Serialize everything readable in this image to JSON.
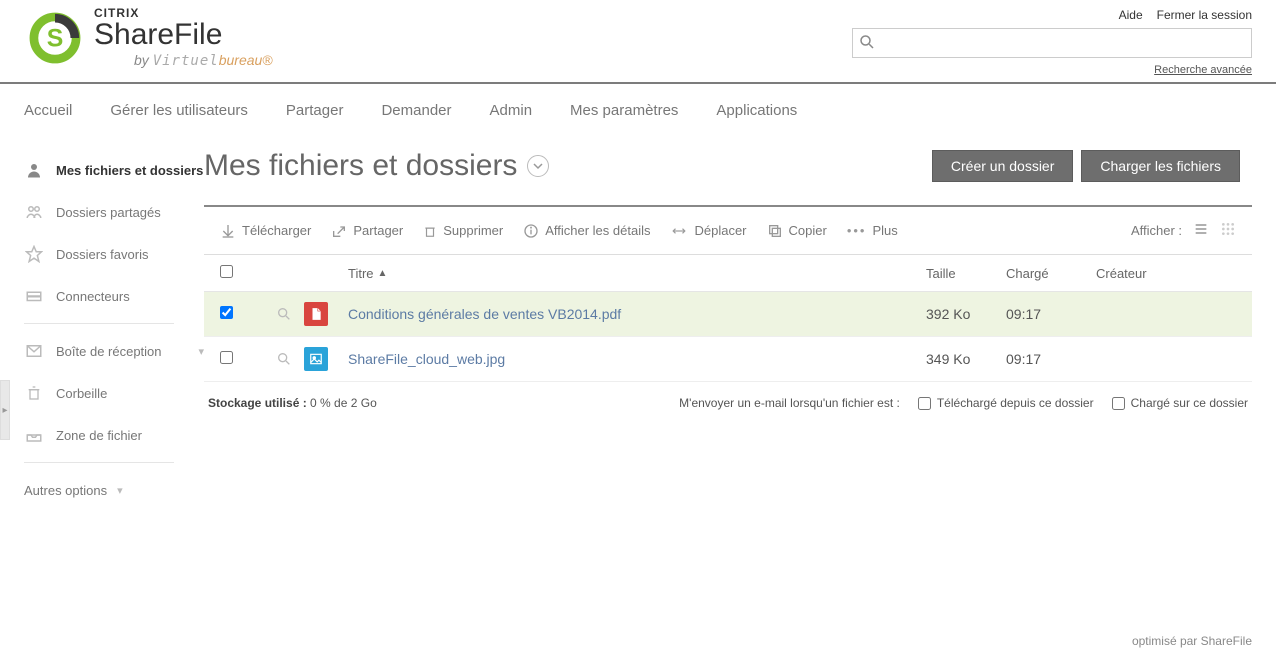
{
  "header": {
    "brand_top": "CITRIX",
    "brand_main": "ShareFile",
    "by": "by ",
    "virtuel": "Virtuel",
    "bureau": "bureau®",
    "help": "Aide",
    "logout": "Fermer la session",
    "search_placeholder": "",
    "advanced_search": "Recherche avancée"
  },
  "nav": {
    "items": [
      "Accueil",
      "Gérer les utilisateurs",
      "Partager",
      "Demander",
      "Admin",
      "Mes paramètres",
      "Applications"
    ]
  },
  "sidebar": {
    "my_files": "Mes fichiers et dossiers",
    "shared": "Dossiers partagés",
    "favorites": "Dossiers favoris",
    "connectors": "Connecteurs",
    "inbox": "Boîte de réception",
    "trash": "Corbeille",
    "filezone": "Zone de fichier",
    "other": "Autres options"
  },
  "content": {
    "title": "Mes fichiers et dossiers",
    "create_folder": "Créer un dossier",
    "upload": "Charger les fichiers"
  },
  "actions": {
    "download": "Télécharger",
    "share": "Partager",
    "delete": "Supprimer",
    "details": "Afficher les détails",
    "move": "Déplacer",
    "copy": "Copier",
    "more": "Plus",
    "display": "Afficher :"
  },
  "table": {
    "col_title": "Titre",
    "col_size": "Taille",
    "col_uploaded": "Chargé",
    "col_creator": "Créateur",
    "rows": [
      {
        "selected": true,
        "type": "pdf",
        "name": "Conditions générales de ventes VB2014.pdf",
        "size": "392 Ko",
        "uploaded": "09:17",
        "creator": " "
      },
      {
        "selected": false,
        "type": "img",
        "name": "ShareFile_cloud_web.jpg",
        "size": "349 Ko",
        "uploaded": "09:17",
        "creator": " "
      }
    ]
  },
  "footer": {
    "storage_label": "Stockage utilisé : ",
    "storage_value": "0 % de 2 Go",
    "notify_label": "M'envoyer un e-mail lorsqu'un fichier est :",
    "notify_download": "Téléchargé depuis ce dossier",
    "notify_upload": "Chargé sur ce dossier"
  },
  "bottom": {
    "optimised": "optimisé par ShareFile"
  }
}
